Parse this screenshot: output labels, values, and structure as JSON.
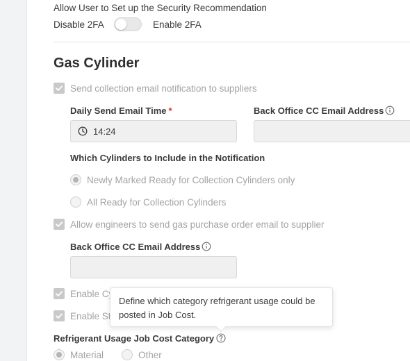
{
  "security": {
    "heading": "Allow User to Set up the Security Recommendation",
    "disable_label": "Disable 2FA",
    "enable_label": "Enable 2FA",
    "toggle_on": false
  },
  "gas_cylinder": {
    "title": "Gas Cylinder",
    "send_collection_email": {
      "label": "Send collection email notification to suppliers",
      "checked": true
    },
    "daily_send_time": {
      "label": "Daily Send Email Time",
      "required_mark": "*",
      "value": "14:24"
    },
    "back_office_cc_1": {
      "label": "Back Office CC Email Address",
      "value": ""
    },
    "which_cylinders": {
      "label": "Which Cylinders to Include in the Notification",
      "options": [
        {
          "label": "Newly Marked Ready for Collection Cylinders only",
          "selected": true
        },
        {
          "label": "All Ready for Collection Cylinders",
          "selected": false
        }
      ]
    },
    "allow_engineers": {
      "label": "Allow engineers to send gas purchase order email to supplier",
      "checked": true
    },
    "back_office_cc_2": {
      "label": "Back Office CC Email Address",
      "value": ""
    },
    "enable_cy": {
      "label": "Enable Cy",
      "checked": true
    },
    "enable_st": {
      "label": "Enable St",
      "checked": true
    },
    "tooltip": {
      "text": "Define which category refrigerant usage could be posted in Job Cost."
    },
    "refrigerant_category": {
      "label": "Refrigerant Usage Job Cost Category",
      "options": [
        {
          "label": "Material",
          "selected": true
        },
        {
          "label": "Other",
          "selected": false
        }
      ]
    }
  },
  "icons": {
    "check": "check-icon",
    "clock": "clock-icon",
    "info": "info-icon",
    "help": "question-circle-icon"
  },
  "colors": {
    "required": "#e02b2b",
    "disabled_fill": "#c9c9c9"
  }
}
